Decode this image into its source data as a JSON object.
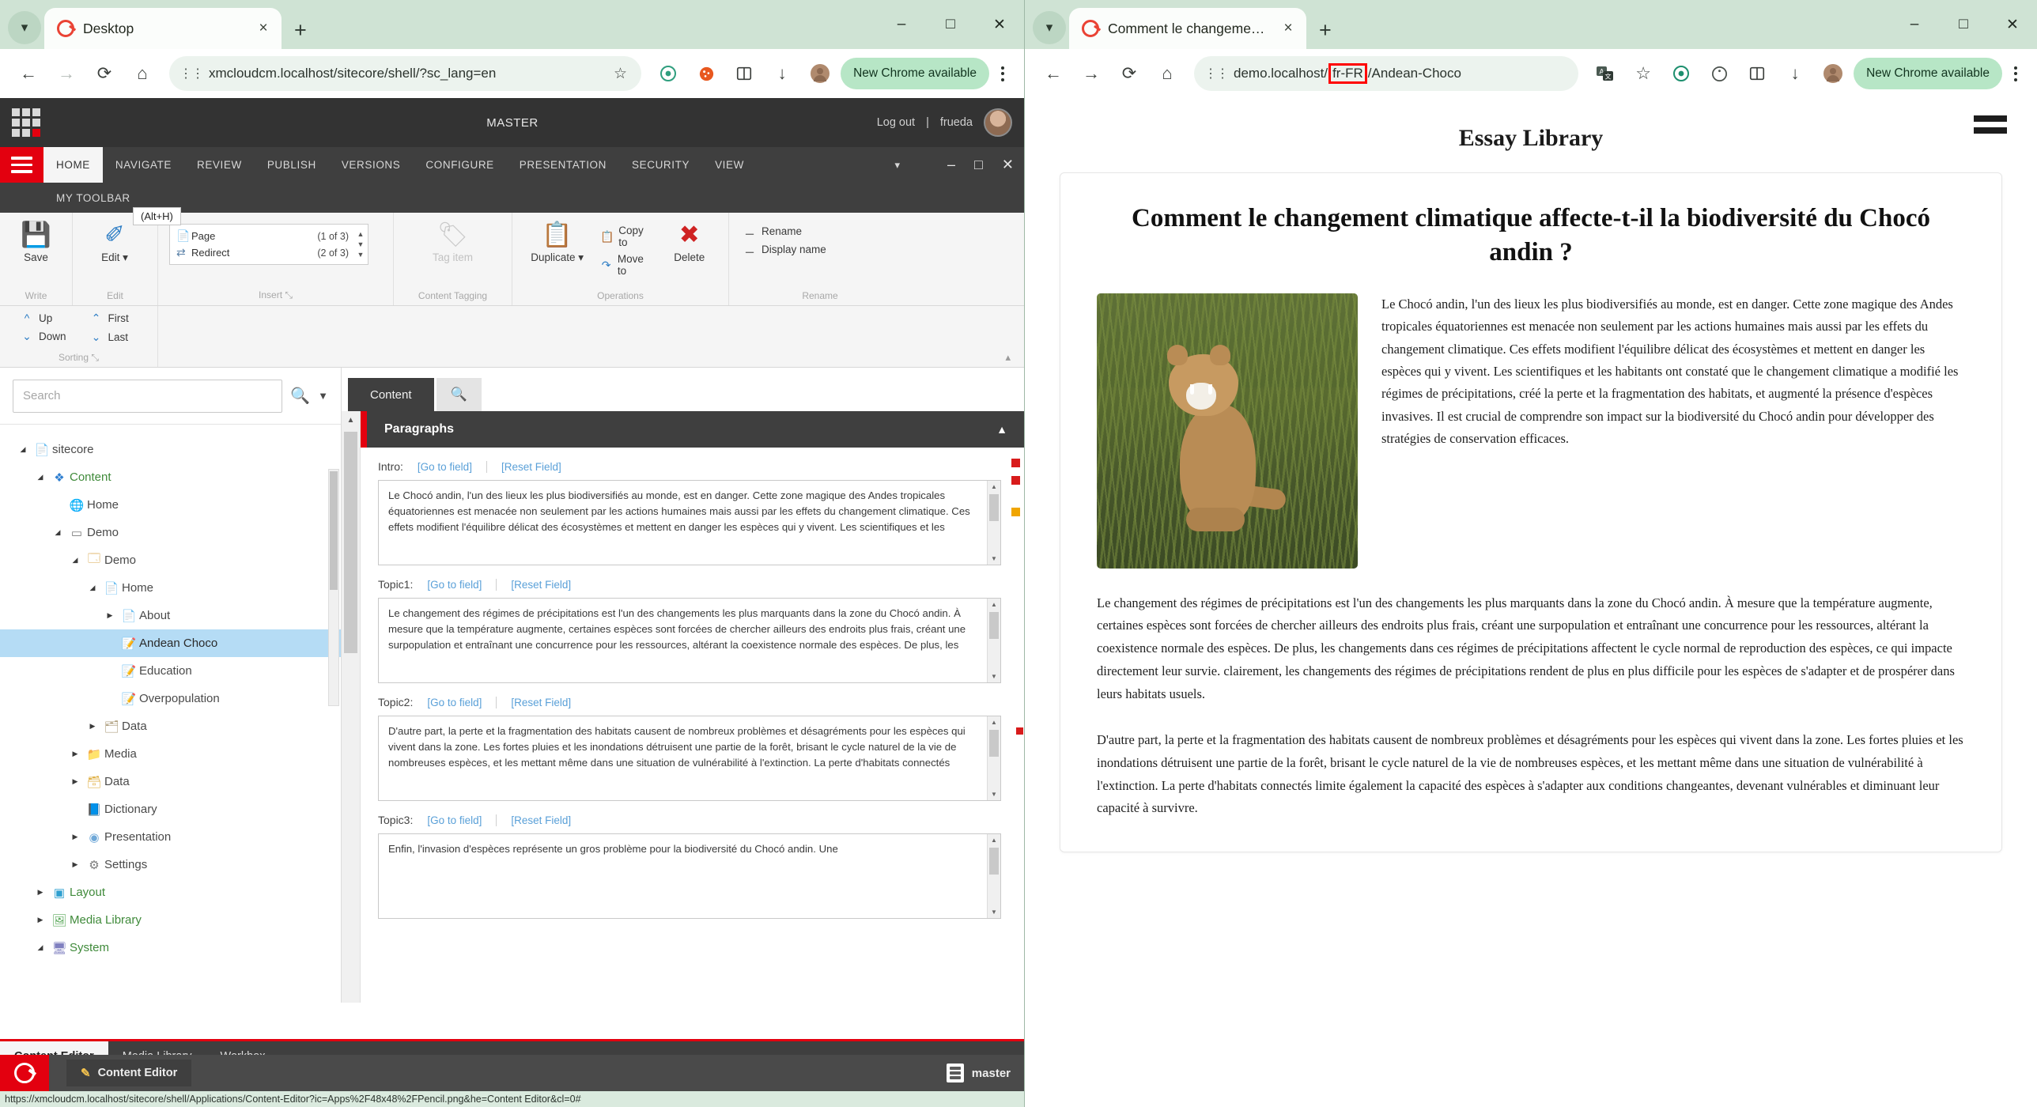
{
  "left_browser": {
    "tab": {
      "title": "Desktop",
      "close_label": "×",
      "new_tab_label": "+"
    },
    "window_controls": {
      "minimize": "–",
      "maximize": "□",
      "close": "✕"
    },
    "omnibox": {
      "back": "←",
      "forward": "→",
      "reload": "⟳",
      "home": "⌂",
      "site_info": "site-info",
      "url": "xmcloudcm.localhost/sitecore/shell/?sc_lang=en",
      "bookmark_star": "☆"
    },
    "toolbar_icons": [
      "extension-puzzle-icon",
      "cookie-icon",
      "split-icon",
      "download-icon",
      "profile-icon"
    ],
    "update_button": "New Chrome available",
    "menu": "chrome-menu-icon"
  },
  "right_browser": {
    "tab": {
      "title": "Comment le changement clima",
      "close_label": "×",
      "new_tab_label": "+"
    },
    "window_controls": {
      "minimize": "–",
      "maximize": "□",
      "close": "✕"
    },
    "omnibox": {
      "back": "←",
      "forward": "→",
      "reload": "⟳",
      "home": "⌂",
      "url_prefix": "demo.localhost/",
      "url_highlight": "fr-FR",
      "url_suffix": "/Andean-Choco",
      "bookmark_star": "☆",
      "highlight_color": "#ff0000"
    },
    "toolbar_icons": [
      "translate-icon",
      "extension-puzzle-icon",
      "cookie-icon",
      "split-icon",
      "download-icon",
      "profile-icon"
    ],
    "update_button": "New Chrome available",
    "menu": "chrome-menu-icon"
  },
  "sitecore": {
    "topbar": {
      "database": "MASTER",
      "logout": "Log out",
      "separator": "|",
      "user": "frueda"
    },
    "ribbon_tabs": [
      {
        "label": "HOME",
        "active": true
      },
      {
        "label": "NAVIGATE",
        "active": false
      },
      {
        "label": "REVIEW",
        "active": false
      },
      {
        "label": "PUBLISH",
        "active": false
      },
      {
        "label": "VERSIONS",
        "active": false
      },
      {
        "label": "CONFIGURE",
        "active": false
      },
      {
        "label": "PRESENTATION",
        "active": false
      },
      {
        "label": "SECURITY",
        "active": false
      },
      {
        "label": "VIEW",
        "active": false
      }
    ],
    "ribbon_tab_second_row": "MY TOOLBAR",
    "tooltip": "(Alt+H)",
    "window_controls": {
      "minimize": "–",
      "maximize": "□",
      "close": "✕",
      "chevron": "▾"
    },
    "groups": {
      "write": {
        "label": "Write",
        "buttons": [
          {
            "label": "Save",
            "icon": "save-icon"
          }
        ]
      },
      "edit": {
        "label": "Edit",
        "buttons": [
          {
            "label": "Edit ▾",
            "icon": "edit-icon"
          }
        ]
      },
      "insert": {
        "label": "Insert",
        "dialog_launcher": "⤡",
        "rows": [
          {
            "icon": "page-icon",
            "name": "Page",
            "count": "(1 of 3)"
          },
          {
            "icon": "redirect-icon",
            "name": "Redirect",
            "count": "(2 of 3)"
          }
        ]
      },
      "content_tagging": {
        "label": "Content Tagging",
        "buttons": [
          {
            "label": "Tag item",
            "icon": "tag-icon",
            "disabled": true
          }
        ]
      },
      "operations": {
        "label": "Operations",
        "duplicate": {
          "label": "Duplicate ▾",
          "icon": "duplicate-icon"
        },
        "items": [
          {
            "label": "Copy to",
            "icon": "copy-icon"
          },
          {
            "label": "Move to",
            "icon": "move-icon"
          }
        ],
        "delete": {
          "label": "Delete",
          "icon": "delete-icon"
        }
      },
      "rename": {
        "label": "Rename",
        "items": [
          {
            "label": "Rename",
            "icon": "rename-icon"
          },
          {
            "label": "Display name",
            "icon": "display-name-icon"
          }
        ]
      },
      "sorting": {
        "label": "Sorting",
        "dialog_launcher": "⤡",
        "items": [
          {
            "label": "Up",
            "icon": "arrow-up-icon"
          },
          {
            "label": "Down",
            "icon": "arrow-down-icon"
          },
          {
            "label": "First",
            "icon": "double-arrow-up-icon"
          },
          {
            "label": "Last",
            "icon": "double-arrow-down-icon"
          }
        ]
      }
    },
    "search": {
      "placeholder": "Search",
      "value": "",
      "search_icon": "search-icon",
      "dropdown_icon": "chevron-down-icon"
    },
    "tree": [
      {
        "label": "sitecore",
        "depth": 0,
        "expander": "◢",
        "icon": "document-icon",
        "icon_color": "#8ab4d8",
        "selected": false,
        "green": false
      },
      {
        "label": "Content",
        "depth": 1,
        "expander": "◢",
        "icon": "content-icon",
        "icon_color": "#2f7fd0",
        "selected": false,
        "green": true
      },
      {
        "label": "Home",
        "depth": 2,
        "expander": "",
        "icon": "globe-icon",
        "icon_color": "#4a9fd8",
        "selected": false,
        "green": false
      },
      {
        "label": "Demo",
        "depth": 2,
        "expander": "◢",
        "icon": "folder-site-icon",
        "icon_color": "#7a7a7a",
        "selected": false,
        "green": false
      },
      {
        "label": "Demo",
        "depth": 3,
        "expander": "◢",
        "icon": "site-icon",
        "icon_color": "#d8a64a",
        "selected": false,
        "green": false
      },
      {
        "label": "Home",
        "depth": 4,
        "expander": "◢",
        "icon": "page-icon",
        "icon_color": "#9a9a9a",
        "selected": false,
        "green": false
      },
      {
        "label": "About",
        "depth": 5,
        "expander": "▶",
        "icon": "page-icon",
        "icon_color": "#9a9a9a",
        "selected": false,
        "green": false
      },
      {
        "label": "Andean Choco",
        "depth": 5,
        "expander": "",
        "icon": "article-icon",
        "icon_color": "#3f7fc0",
        "selected": true,
        "green": false
      },
      {
        "label": "Education",
        "depth": 5,
        "expander": "",
        "icon": "article-icon",
        "icon_color": "#3f7fc0",
        "selected": false,
        "green": false
      },
      {
        "label": "Overpopulation",
        "depth": 5,
        "expander": "",
        "icon": "article-icon",
        "icon_color": "#3f7fc0",
        "selected": false,
        "green": false
      },
      {
        "label": "Data",
        "depth": 4,
        "expander": "▶",
        "icon": "data-folder-icon",
        "icon_color": "#b0a080",
        "selected": false,
        "green": false
      },
      {
        "label": "Media",
        "depth": 3,
        "expander": "▶",
        "icon": "media-icon",
        "icon_color": "#e0b24a",
        "selected": false,
        "green": false
      },
      {
        "label": "Data",
        "depth": 3,
        "expander": "▶",
        "icon": "database-icon",
        "icon_color": "#e0b24a",
        "selected": false,
        "green": false
      },
      {
        "label": "Dictionary",
        "depth": 3,
        "expander": "",
        "icon": "book-icon",
        "icon_color": "#2f7fd0",
        "selected": false,
        "green": false
      },
      {
        "label": "Presentation",
        "depth": 3,
        "expander": "▶",
        "icon": "presentation-icon",
        "icon_color": "#6fa8d8",
        "selected": false,
        "green": false
      },
      {
        "label": "Settings",
        "depth": 3,
        "expander": "▶",
        "icon": "settings-icon",
        "icon_color": "#7a7a7a",
        "selected": false,
        "green": false
      },
      {
        "label": "Layout",
        "depth": 1,
        "expander": "▶",
        "icon": "layout-icon",
        "icon_color": "#2f9fd0",
        "selected": false,
        "green": true
      },
      {
        "label": "Media Library",
        "depth": 1,
        "expander": "▶",
        "icon": "media-library-icon",
        "icon_color": "#5aa85a",
        "selected": false,
        "green": true
      },
      {
        "label": "System",
        "depth": 1,
        "expander": "◢",
        "icon": "system-icon",
        "icon_color": "#8080c0",
        "selected": false,
        "green": true
      }
    ],
    "content_tabs": [
      {
        "label": "Content",
        "active": true
      },
      {
        "label": "🔍",
        "active": false
      }
    ],
    "section": {
      "title": "Paragraphs",
      "collapse_icon": "chevron-up-icon"
    },
    "fields": [
      {
        "name": "Intro:",
        "go_to_field": "[Go to field]",
        "reset_field": "[Reset Field]",
        "value": "Le Chocó andin, l'un des lieux les plus biodiversifiés au monde, est en danger. Cette zone magique des Andes tropicales équatoriennes est menacée non seulement par les actions humaines mais aussi par les effets du changement climatique. Ces effets modifient l'équilibre délicat des écosystèmes et mettent en danger les espèces qui y vivent. Les scientifiques et les"
      },
      {
        "name": "Topic1:",
        "go_to_field": "[Go to field]",
        "reset_field": "[Reset Field]",
        "value": "Le changement des régimes de précipitations est l'un des changements les plus marquants dans la zone du Chocó andin. À mesure que la température augmente, certaines espèces sont forcées de chercher ailleurs des endroits plus frais, créant une surpopulation et entraînant une concurrence pour les ressources, altérant la coexistence normale des espèces. De plus, les"
      },
      {
        "name": "Topic2:",
        "go_to_field": "[Go to field]",
        "reset_field": "[Reset Field]",
        "value": "D'autre part, la perte et la fragmentation des habitats causent de nombreux problèmes et désagréments pour les espèces qui vivent dans la zone. Les fortes pluies et les inondations détruisent une partie de la forêt, brisant le cycle naturel de la vie de nombreuses espèces, et les mettant même dans une situation de vulnérabilité à l'extinction. La perte d'habitats connectés"
      },
      {
        "name": "Topic3:",
        "go_to_field": "[Go to field]",
        "reset_field": "[Reset Field]",
        "value": "Enfin, l'invasion d'espèces représente un gros problème pour la biodiversité du Chocó andin. Une"
      }
    ],
    "app_tabs": [
      {
        "label": "Content Editor",
        "active": true
      },
      {
        "label": "Media Library",
        "active": false
      },
      {
        "label": "Workbox",
        "active": false
      }
    ],
    "taskbar": {
      "item": "Content Editor",
      "item_icon": "pencil-icon",
      "logo": "sitecore-logo",
      "database": "master",
      "database_icon": "database-icon"
    },
    "status_url": "https://xmcloudcm.localhost/sitecore/shell/Applications/Content-Editor?ic=Apps%2F48x48%2FPencil.png&he=Content Editor&cl=0#"
  },
  "website": {
    "menu_icon": "hamburger-menu-icon",
    "site_title": "Essay Library",
    "article_title": "Comment le changement climatique affecte-t-il la biodiversité du Chocó andin ?",
    "image_alt": "puma-photo",
    "intro": "Le Chocó andin, l'un des lieux les plus biodiversifiés au monde, est en danger. Cette zone magique des Andes tropicales équatoriennes est menacée non seulement par les actions humaines mais aussi par les effets du changement climatique. Ces effets modifient l'équilibre délicat des écosystèmes et mettent en danger les espèces qui y vivent. Les scientifiques et les habitants ont constaté que le changement climatique a modifié les régimes de précipitations, créé la perte et la fragmentation des habitats, et augmenté la présence d'espèces invasives. Il est crucial de comprendre son impact sur la biodiversité du Chocó andin pour développer des stratégies de conservation efficaces.",
    "paragraph1": "Le changement des régimes de précipitations est l'un des changements les plus marquants dans la zone du Chocó andin. À mesure que la température augmente, certaines espèces sont forcées de chercher ailleurs des endroits plus frais, créant une surpopulation et entraînant une concurrence pour les ressources, altérant la coexistence normale des espèces. De plus, les changements dans ces régimes de précipitations affectent le cycle normal de reproduction des espèces, ce qui impacte directement leur survie. clairement, les changements des régimes de précipitations rendent de plus en plus difficile pour les espèces de s'adapter et de prospérer dans leurs habitats usuels.",
    "paragraph2": "D'autre part, la perte et la fragmentation des habitats causent de nombreux problèmes et désagréments pour les espèces qui vivent dans la zone. Les fortes pluies et les inondations détruisent une partie de la forêt, brisant le cycle naturel de la vie de nombreuses espèces, et les mettant même dans une situation de vulnérabilité à l'extinction. La perte d'habitats connectés limite également la capacité des espèces à s'adapter aux conditions changeantes, devenant vulnérables et diminuant leur capacité à survivre."
  }
}
